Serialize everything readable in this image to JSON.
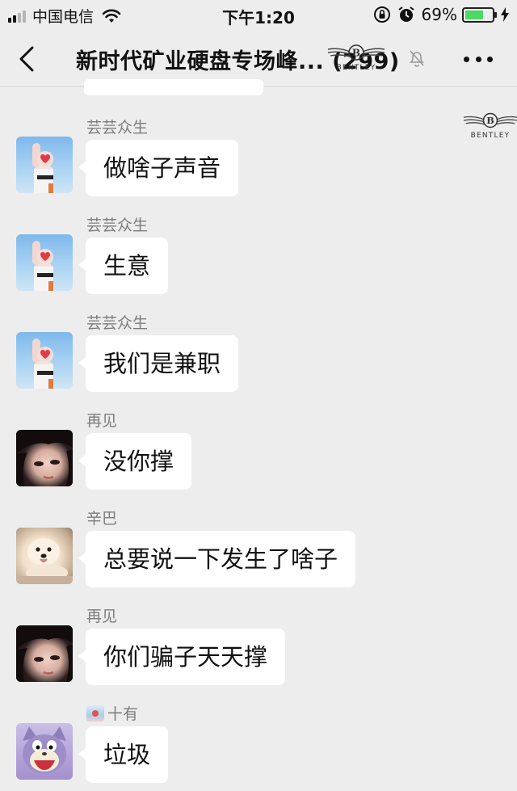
{
  "status_bar": {
    "carrier": "中国电信",
    "time": "下午1:20",
    "battery_percent_label": "69%",
    "battery_level": 0.69,
    "icons": [
      "signal-icon",
      "wifi-icon",
      "orientation-lock-icon",
      "alarm-icon",
      "battery-icon",
      "charging-icon"
    ]
  },
  "nav": {
    "title": "新时代矿业硬盘专场峰... (299)",
    "back_icon": "chevron-left-icon",
    "mute_icon": "bell-muted-icon",
    "more_icon": "more-dots-icon"
  },
  "watermark": {
    "brand": "BENTLEY",
    "logo_letter": "B"
  },
  "messages": [
    {
      "sender": "芸芸众生",
      "text": "做啥子声音",
      "avatar": "cartoon-figure-avatar"
    },
    {
      "sender": "芸芸众生",
      "text": "生意",
      "avatar": "cartoon-figure-avatar"
    },
    {
      "sender": "芸芸众生",
      "text": "我们是兼职",
      "avatar": "cartoon-figure-avatar"
    },
    {
      "sender": "再见",
      "text": "没你撑",
      "avatar": "girl-portrait-avatar"
    },
    {
      "sender": "辛巴",
      "text": "总要说一下发生了啥子",
      "avatar": "dog-avatar"
    },
    {
      "sender": "再见",
      "text": "你们骗子天天撑",
      "avatar": "girl-portrait-avatar"
    },
    {
      "sender": "十有",
      "text": "垃圾",
      "avatar": "tom-cat-avatar",
      "sender_badge": "sticker-icon"
    }
  ]
}
